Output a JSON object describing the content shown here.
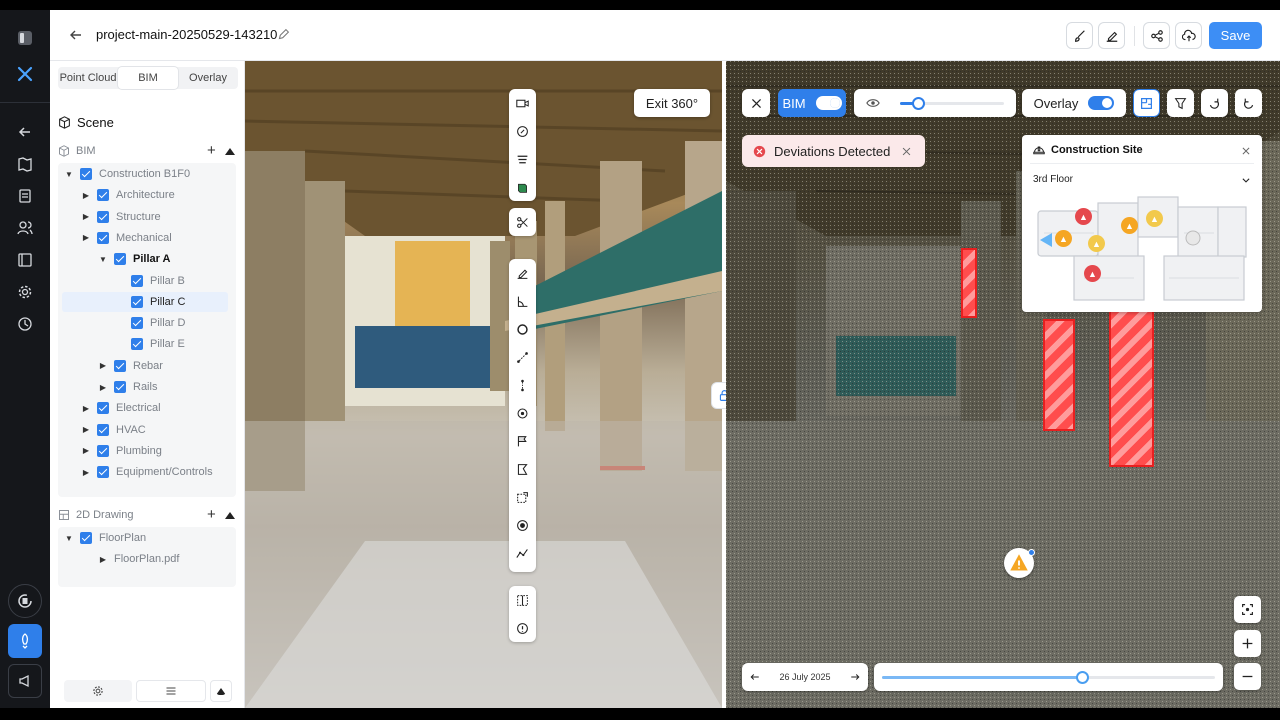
{
  "header": {
    "title": "project-main-20250529-143210",
    "save_label": "Save"
  },
  "panel": {
    "tabs": [
      {
        "label": "Point Cloud",
        "active": false
      },
      {
        "label": "BIM",
        "active": true
      },
      {
        "label": "Overlay",
        "active": false
      }
    ],
    "scene_label": "Scene",
    "bim_label": "BIM",
    "bim_tree": [
      {
        "label": "Construction B1F0",
        "level": 0,
        "caret": "down",
        "style": "normal"
      },
      {
        "label": "Architecture",
        "level": 1,
        "caret": "right",
        "style": "normal"
      },
      {
        "label": "Structure",
        "level": 1,
        "caret": "right",
        "style": "normal"
      },
      {
        "label": "Mechanical",
        "level": 1,
        "caret": "right",
        "style": "normal"
      },
      {
        "label": "Pillar A",
        "level": 2,
        "caret": "down",
        "style": "bold"
      },
      {
        "label": "Pillar B",
        "level": 3,
        "caret": "",
        "style": "normal"
      },
      {
        "label": "Pillar C",
        "level": 3,
        "caret": "",
        "style": "dark",
        "selected": true
      },
      {
        "label": "Pillar D",
        "level": 3,
        "caret": "",
        "style": "normal"
      },
      {
        "label": "Pillar E",
        "level": 3,
        "caret": "",
        "style": "normal"
      },
      {
        "label": "Rebar",
        "level": 2,
        "caret": "right",
        "style": "normal"
      },
      {
        "label": "Rails",
        "level": 2,
        "caret": "right",
        "style": "normal"
      },
      {
        "label": "Electrical",
        "level": 1,
        "caret": "right",
        "style": "normal"
      },
      {
        "label": "HVAC",
        "level": 1,
        "caret": "right",
        "style": "normal"
      },
      {
        "label": "Plumbing",
        "level": 1,
        "caret": "right",
        "style": "normal"
      },
      {
        "label": "Equipment/Controls",
        "level": 1,
        "caret": "right",
        "style": "normal"
      }
    ],
    "drawing_label": "2D Drawing",
    "drawing_tree": [
      {
        "label": "FloorPlan",
        "level": 0,
        "caret": "down",
        "checkbox": true
      },
      {
        "label": "FloorPlan.pdf",
        "level": 2,
        "caret": "right",
        "checkbox": false
      }
    ]
  },
  "viewer_left": {
    "exit_label": "Exit 360°"
  },
  "viewer_right": {
    "bim_toggle_label": "BIM",
    "bim_toggle_on": true,
    "opacity_level": 0.17,
    "overlay_label": "Overlay",
    "overlay_toggle_on": true,
    "deviations_label": "Deviations Detected",
    "site_card": {
      "title": "Construction Site",
      "floor": "3rd Floor"
    },
    "timeline": {
      "date": "26 July 2025",
      "position": 0.6
    }
  },
  "colors": {
    "accent": "#3d8ef5",
    "deviation": "#e5484d",
    "warning": "#f5a623",
    "caution": "#f2c94c"
  }
}
